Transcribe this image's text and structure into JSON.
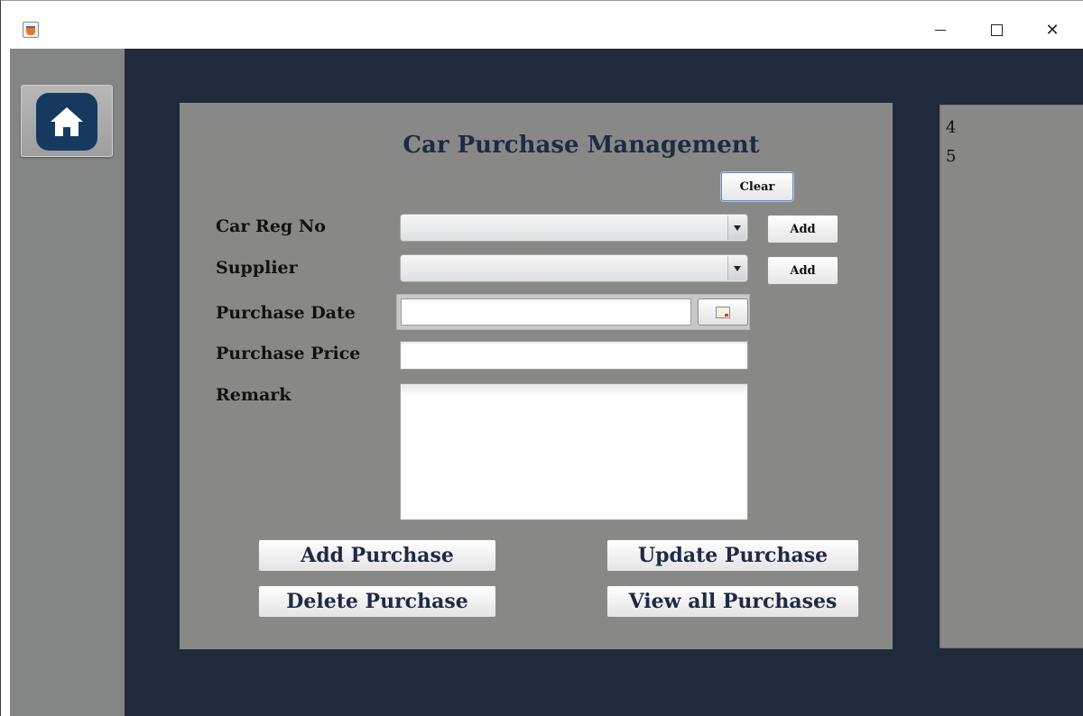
{
  "window": {
    "controls": {
      "minimize_icon": "minimize-icon",
      "maximize_icon": "maximize-icon",
      "close_icon": "close-icon",
      "close_glyph": "✕"
    }
  },
  "sidebar": {
    "home_icon": "home-icon"
  },
  "form": {
    "title": "Car Purchase Management",
    "clear_label": "Clear",
    "fields": {
      "car_reg_no": {
        "label": "Car Reg No",
        "value": "",
        "add_label": "Add"
      },
      "supplier": {
        "label": "Supplier",
        "value": "",
        "add_label": "Add"
      },
      "purchase_date": {
        "label": "Purchase Date",
        "value": ""
      },
      "purchase_price": {
        "label": "Purchase Price",
        "value": ""
      },
      "remark": {
        "label": "Remark",
        "value": ""
      }
    },
    "actions": {
      "add": "Add Purchase",
      "update": "Update Purchase",
      "delete": "Delete Purchase",
      "view_all": "View all Purchases"
    }
  },
  "side_list": {
    "items": [
      "4",
      "5"
    ]
  },
  "colors": {
    "main_bg": "#212a3a",
    "panel_bg": "#888987",
    "sidebar_bg": "#848685",
    "home_tile": "#163a5f",
    "title_text": "#1f2a44"
  }
}
